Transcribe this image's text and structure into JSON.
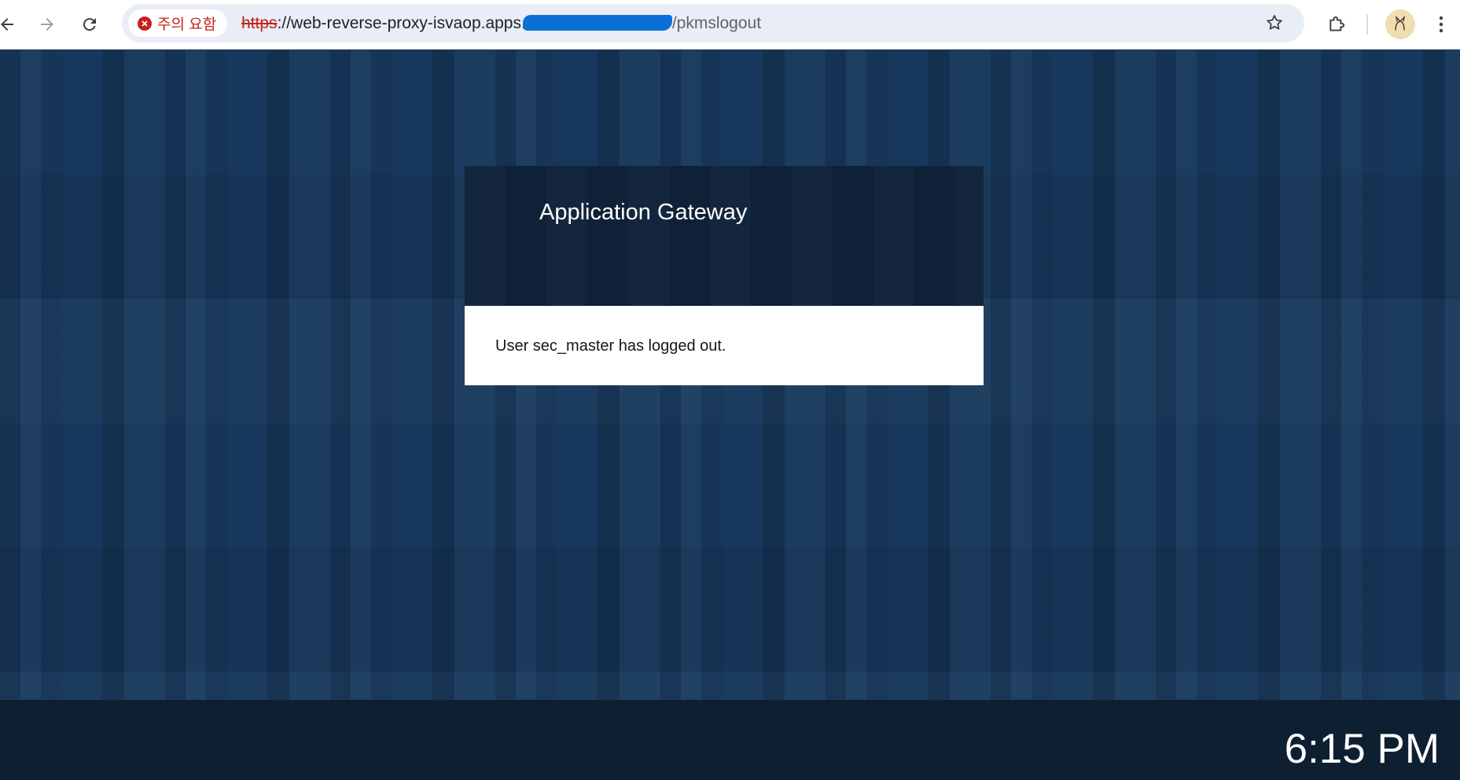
{
  "browser": {
    "security_chip_label": "주의 요함",
    "url": {
      "scheme": "https",
      "host_prefix": "://web-reverse-proxy-isvaop.apps.",
      "path": "/pkmslogout"
    }
  },
  "page": {
    "card_title": "Application Gateway",
    "logout_message": "User sec_master has logged out."
  },
  "taskbar": {
    "clock": "6:15 PM"
  },
  "colors": {
    "page_background": "#17385c",
    "card_header": "#0f233a",
    "security_warning": "#c5221f",
    "redaction": "#0a6fd6"
  }
}
